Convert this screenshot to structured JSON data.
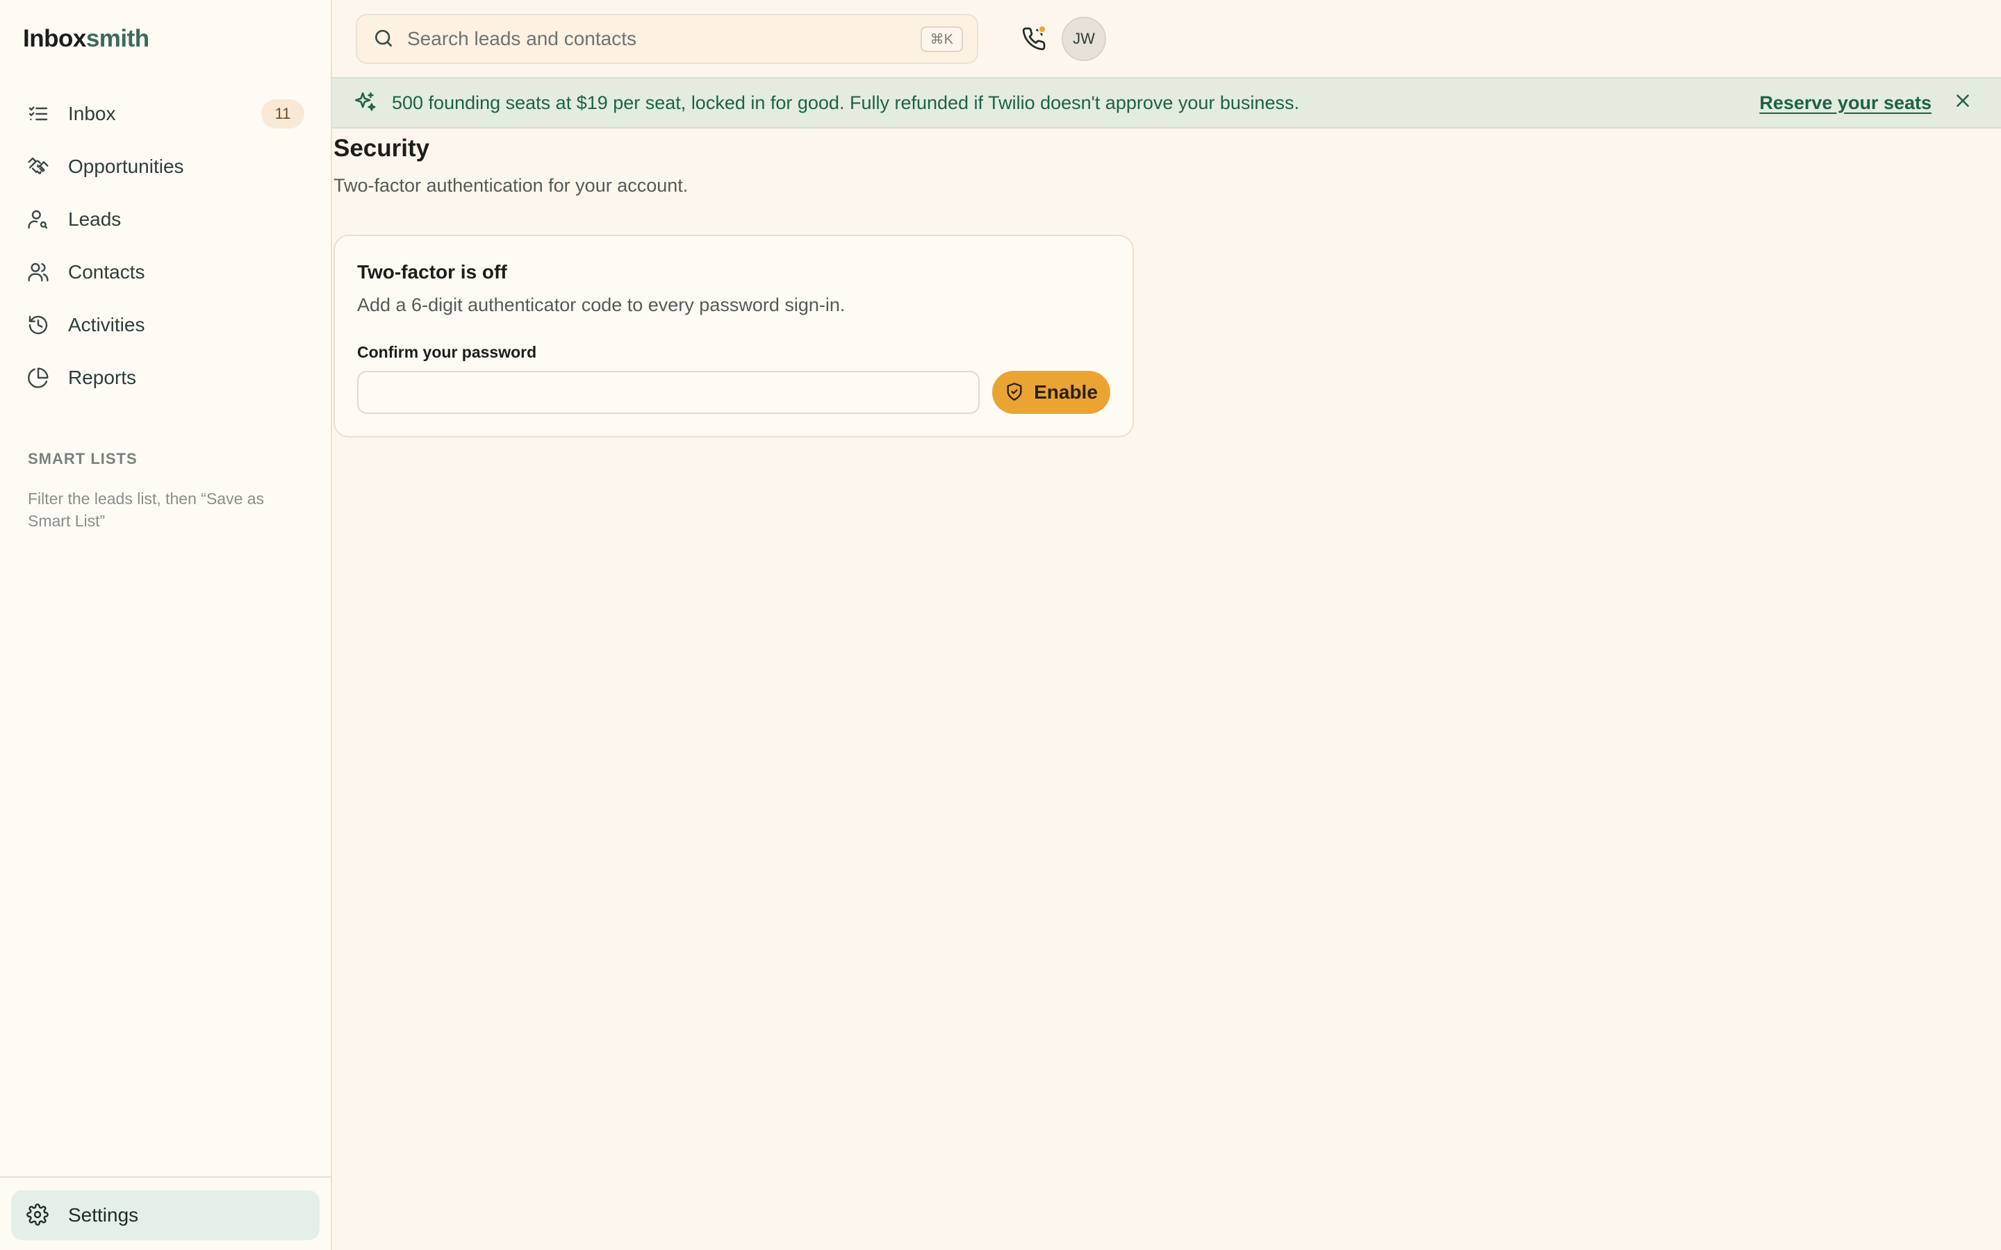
{
  "brand": {
    "part1": "Inbox",
    "part2": "smith"
  },
  "sidebar": {
    "items": [
      {
        "label": "Inbox",
        "icon": "list-check-icon",
        "badge": "11"
      },
      {
        "label": "Opportunities",
        "icon": "handshake-icon"
      },
      {
        "label": "Leads",
        "icon": "user-search-icon"
      },
      {
        "label": "Contacts",
        "icon": "users-icon"
      },
      {
        "label": "Activities",
        "icon": "history-icon"
      },
      {
        "label": "Reports",
        "icon": "pie-chart-icon"
      }
    ],
    "smart_lists_heading": "SMART LISTS",
    "smart_lists_hint": "Filter the leads list, then “Save as Smart List”",
    "settings_label": "Settings"
  },
  "topbar": {
    "search_placeholder": "Search leads and contacts",
    "shortcut": "⌘K",
    "avatar_initials": "JW"
  },
  "banner": {
    "message": "500 founding seats at $19 per seat, locked in for good. Fully refunded if Twilio doesn't approve your business.",
    "cta": "Reserve your seats"
  },
  "main": {
    "title": "Security",
    "subtitle": "Two-factor authentication for your account.",
    "card": {
      "title": "Two-factor is off",
      "description": "Add a 6-digit authenticator code to every password sign-in.",
      "field_label": "Confirm your password",
      "password_value": "",
      "button_label": "Enable"
    }
  },
  "colors": {
    "background": "#fdf6ec",
    "accent_green": "#1e6148",
    "button_amber": "#eba431",
    "banner_bg": "#e3ecdf"
  }
}
